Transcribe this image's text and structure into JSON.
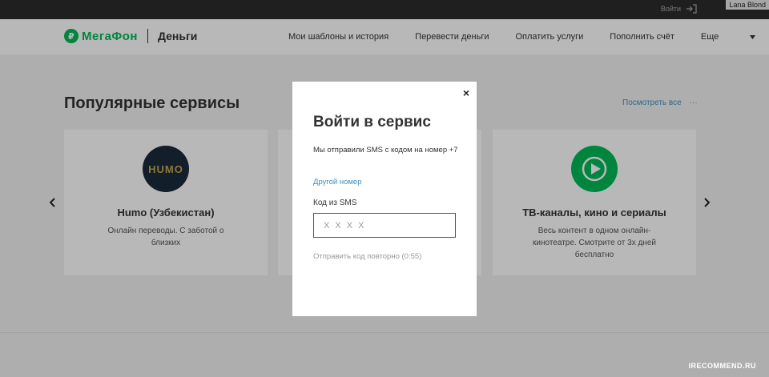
{
  "topbar": {
    "login_label": "Войти",
    "user_tag": "Lana Blond"
  },
  "header": {
    "logo_text": "МегаФон",
    "logo_sub": "Деньги",
    "nav": [
      "Мои шаблоны и история",
      "Перевести деньги",
      "Оплатить услуги",
      "Пополнить счёт"
    ],
    "more_label": "Еще"
  },
  "main": {
    "section_title": "Популярные сервисы",
    "see_all": "Посмотреть все",
    "see_all_dots": "···",
    "cards": [
      {
        "icon_text": "HUMO",
        "title": "Humo (Узбекистан)",
        "desc": "Онлайн переводы. С заботой о близких"
      },
      {
        "icon_text": "",
        "title": "",
        "desc": ""
      },
      {
        "icon_text": "",
        "title": "ТВ-каналы, кино и сериалы",
        "desc": "Весь контент в одном онлайн-кинотеатре. Смотрите от 3х дней бесплатно"
      }
    ]
  },
  "modal": {
    "close_glyph": "×",
    "title": "Войти в сервис",
    "text": "Мы отправили SMS с кодом на номер +7",
    "other_number": "Другой номер",
    "code_label": "Код из SMS",
    "code_placeholder": "X X X X",
    "resend": "Отправить код повторно (0:55)"
  },
  "watermark": "IRECOMMEND.RU",
  "colors": {
    "brand_green": "#00b956",
    "link_blue": "#3a8fc4"
  },
  "icons": {
    "login": "login-icon",
    "chevron_down": "chevron-down-icon",
    "arrow_left": "chevron-left-icon",
    "arrow_right": "chevron-right-icon",
    "play": "play-icon"
  }
}
